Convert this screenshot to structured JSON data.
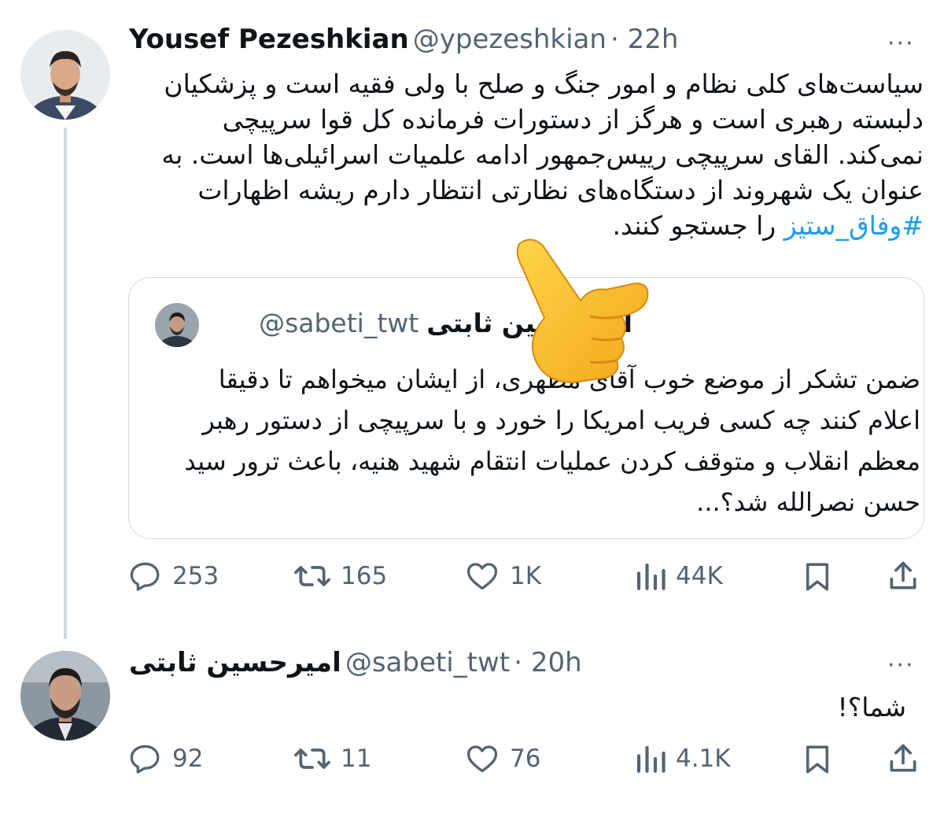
{
  "tweet1": {
    "name": "Yousef Pezeshkian",
    "handle": "@ypezeshkian",
    "time": "· 22h",
    "more": "···",
    "text_part1": "سیاست‌های کلی نظام و امور جنگ و صلح با ولی فقیه است و پزشکیان دلبسته رهبری است و هرگز از دستورات فرمانده کل قوا سرپیچی نمی‌کند. القای سرپیچی رییس‌جمهور ادامه علمیات اسرائیلی‌ها است. به عنوان یک شهروند از دستگاه‌های نظارتی انتظار دارم ریشه اظهارات ",
    "hashtag": "#وفاق_ستیز",
    "text_part2": " را جستجو کنند.",
    "quote": {
      "name": "امیرحسین ثابتی",
      "handle": "@sabeti_twt",
      "text": "ضمن تشکر از موضع خوب آقای مطهری، از ایشان میخواهم تا دقیقا اعلام کنند چه کسی فریب امریکا را خورد و با سرپیچی از دستور رهبر معظم انقلاب و متوقف کردن عملیات انتقام شهید هنیه، باعث ترور سید حسن نصرالله شد؟..."
    },
    "stats": {
      "replies": "253",
      "retweets": "165",
      "likes": "1K",
      "views": "44K"
    }
  },
  "tweet2": {
    "name": "امیرحسین ثابتی",
    "handle": "@sabeti_twt",
    "time": "· 20h",
    "more": "···",
    "text": "شما؟!",
    "stats": {
      "replies": "92",
      "retweets": "11",
      "likes": "76",
      "views": "4.1K"
    }
  },
  "icons": {
    "reply": "reply-icon",
    "retweet": "retweet-icon",
    "like": "heart-icon",
    "views": "views-icon",
    "bookmark": "bookmark-icon",
    "share": "share-icon",
    "overlay": "pointing-hand-emoji"
  },
  "colors": {
    "text": "#0f1419",
    "secondary": "#536471",
    "link": "#1d9bf0",
    "border": "#cfd9de"
  }
}
